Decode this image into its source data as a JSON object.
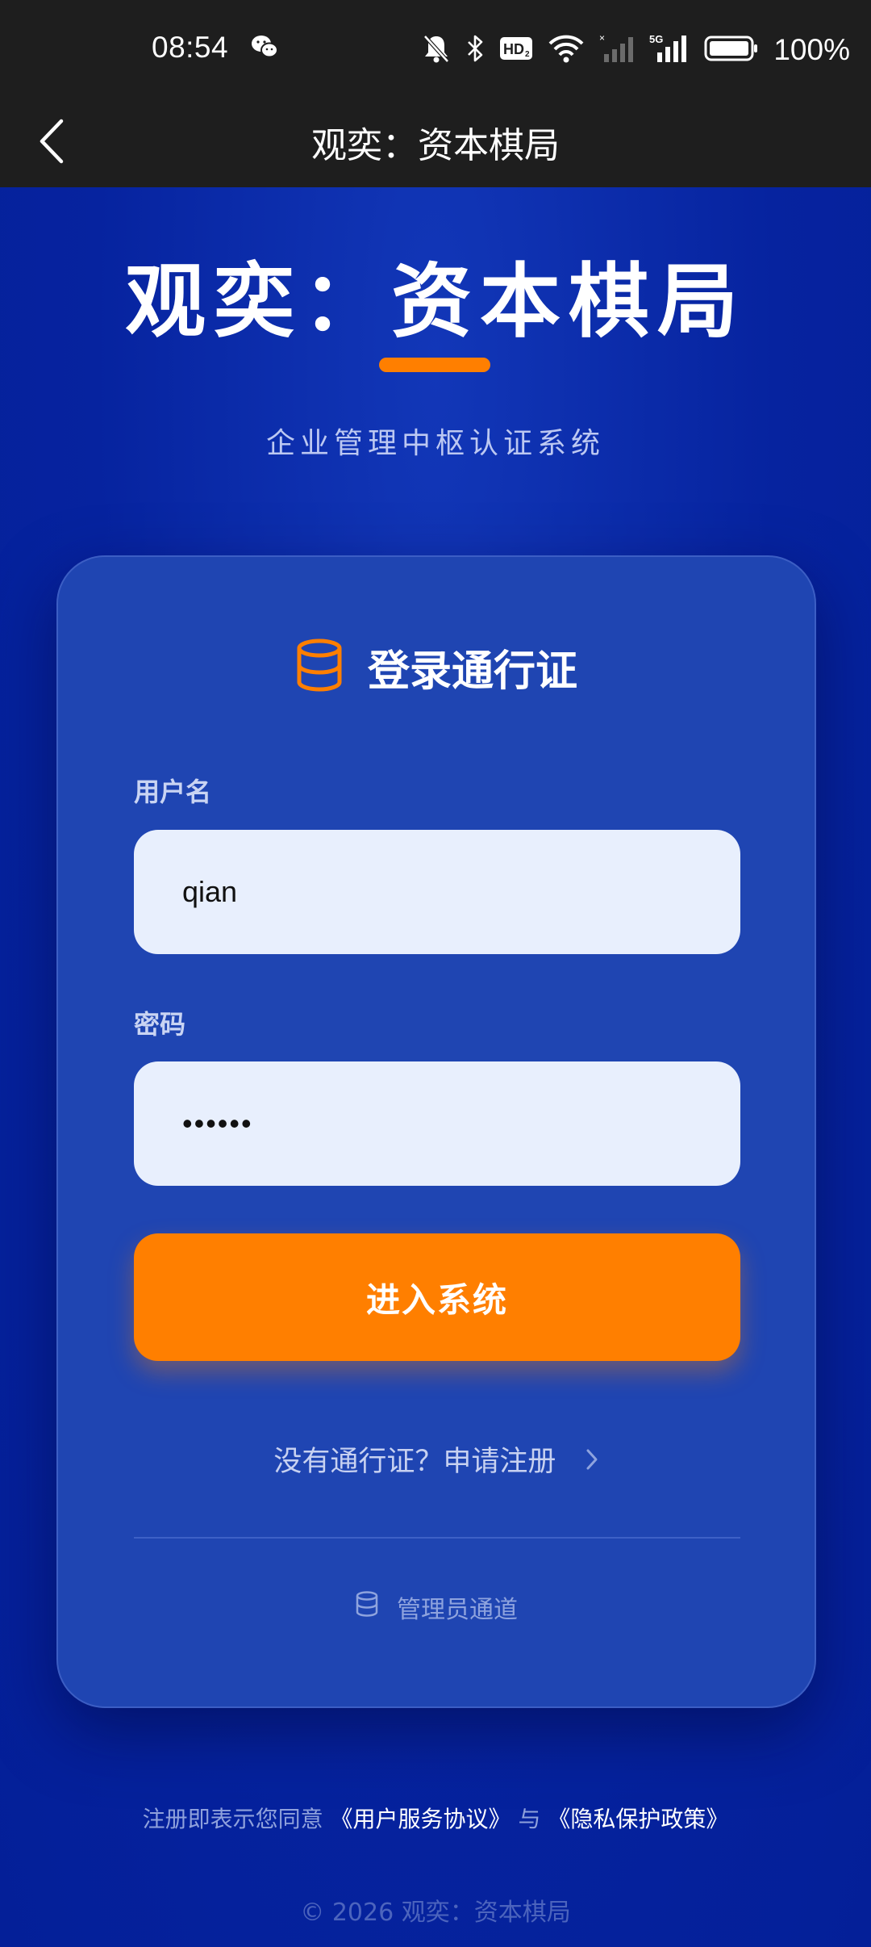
{
  "status_bar": {
    "time": "08:54",
    "battery": "100%",
    "icons": [
      "wechat-icon",
      "mute-icon",
      "bluetooth-icon",
      "hd-icon",
      "wifi-icon",
      "signal-icon",
      "5g-signal-icon",
      "battery-icon"
    ]
  },
  "app_bar": {
    "title": "观奕：资本棋局",
    "back_icon": "chevron-left-icon"
  },
  "hero": {
    "title": "观奕：资本棋局",
    "subtitle": "企业管理中枢认证系统",
    "accent_color": "#ff7f00"
  },
  "login_card": {
    "icon": "database-icon",
    "title": "登录通行证",
    "username_label": "用户名",
    "username_value": "qian",
    "password_label": "密码",
    "password_value": "••••••",
    "submit_label": "进入系统",
    "register_text": "没有通行证？申请注册",
    "admin_icon": "database-icon",
    "admin_text": "管理员通道"
  },
  "footer": {
    "agreement_prefix": "注册即表示您同意",
    "terms_link": "《用户服务协议》",
    "and": "与",
    "privacy_link": "《隐私保护政策》",
    "copyright": "© 2026 观奕：资本棋局"
  },
  "colors": {
    "background": "#06239f",
    "card": "#1f45b2",
    "button": "#ff7f00",
    "input": "#e8effd",
    "status_bar": "#1e1e1e"
  }
}
